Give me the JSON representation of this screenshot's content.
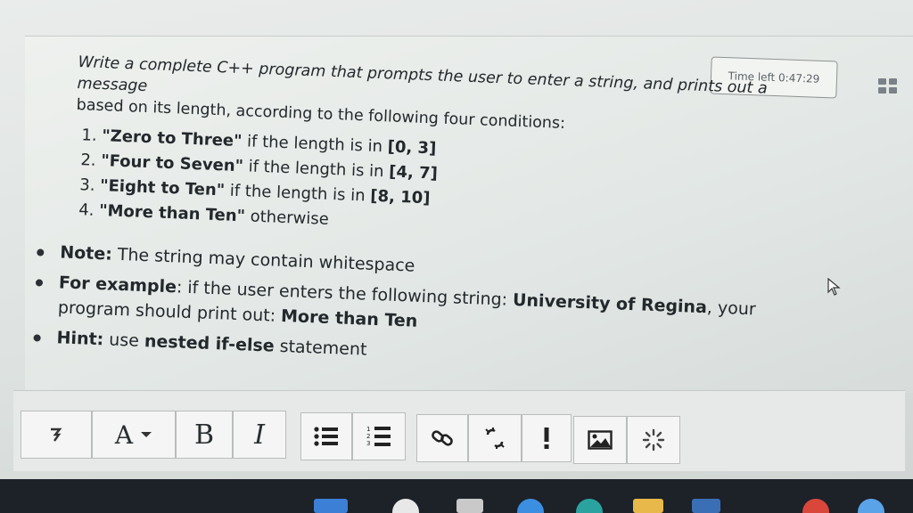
{
  "timer": {
    "label": "Time left 0:47:29"
  },
  "question": {
    "prompt_line1": "Write a complete C++ program that prompts the user to enter a string, and prints out a message",
    "prompt_line2": "based on its length, according to the following four conditions:",
    "conditions": [
      {
        "label": "\"Zero to Three\"",
        "text": " if the length is in ",
        "range": "[0, 3]"
      },
      {
        "label": "\"Four to Seven\"",
        "text": " if the length is in ",
        "range": "[4, 7]"
      },
      {
        "label": "\"Eight to Ten\"",
        "text": " if the length is in ",
        "range": "[8, 10]"
      },
      {
        "label": "\"More than Ten\"",
        "text": " otherwise",
        "range": ""
      }
    ],
    "notes": [
      {
        "lead": "Note:",
        "text": " The string may contain whitespace"
      },
      {
        "lead": "For example",
        "text": ": if the user enters the following string: ",
        "emph": "University of Regina",
        "text2": ", your program should print out: ",
        "emph2": "More than Ten"
      },
      {
        "lead": "Hint:",
        "text": " use ",
        "emph": "nested if-else",
        "text2": " statement"
      }
    ]
  },
  "toolbar": {
    "collapse_icon": "collapse-toolbar-icon",
    "font_label": "A",
    "bold_label": "B",
    "italic_label": "I",
    "buttons": [
      "font-size-menu",
      "bold",
      "italic",
      "unordered-list",
      "ordered-list",
      "link",
      "unlink",
      "emoticon",
      "insert-image",
      "insert-media"
    ]
  },
  "colors": {
    "panel": "#e6eae8",
    "text": "#23282c",
    "taskbar": "#1d2128"
  }
}
